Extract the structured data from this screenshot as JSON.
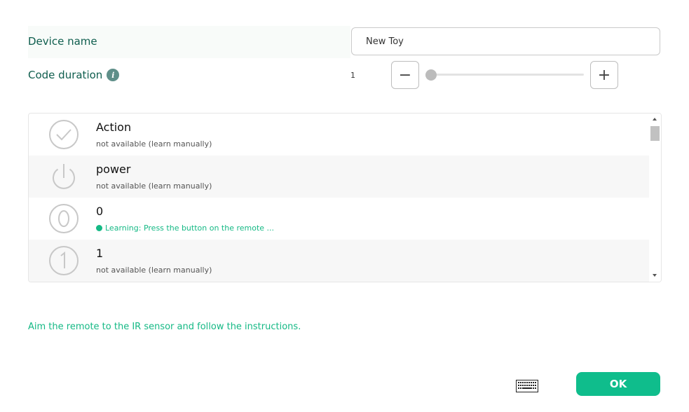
{
  "device": {
    "label": "Device name",
    "value": "New Toy"
  },
  "duration": {
    "label": "Code duration",
    "value": "1",
    "minus_symbol": "−",
    "plus_symbol": "+",
    "slider_fraction": 0
  },
  "items": [
    {
      "title": "Action",
      "status": "not available (learn manually)",
      "icon": "checkmark-circle-icon"
    },
    {
      "title": "power",
      "status": "not available (learn manually)",
      "icon": "power-icon"
    },
    {
      "title": "0",
      "status": "Learning: Press the button on the remote ...",
      "icon": "digit-zero-circle-icon"
    },
    {
      "title": "1",
      "status": "not available (learn manually)",
      "icon": "digit-one-circle-icon"
    }
  ],
  "instructions": "Aim the remote to the IR sensor and follow the instructions.",
  "ok_label": "OK",
  "colors": {
    "accent": "#0fbd8c",
    "learning": "#15b985",
    "label": "#0f5e4e"
  }
}
